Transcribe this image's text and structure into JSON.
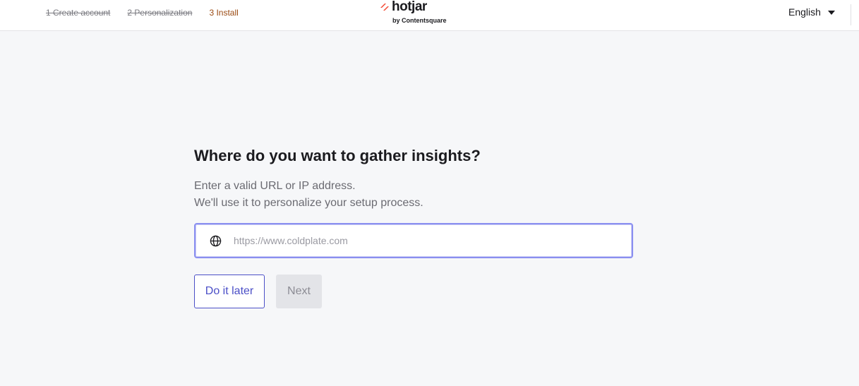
{
  "header": {
    "steps": [
      {
        "label": "1 Create account",
        "state": "done"
      },
      {
        "label": "2 Personalization",
        "state": "done"
      },
      {
        "label": "3 Install",
        "state": "current"
      }
    ],
    "logo": {
      "name": "hotjar",
      "tagline": "by Contentsquare",
      "mark_color": "#f4442e"
    },
    "language": {
      "selected": "English",
      "icon": "chevron-down-icon"
    }
  },
  "main": {
    "title": "Where do you want to gather insights?",
    "description_line1": "Enter a valid URL or IP address.",
    "description_line2": "We'll use it to personalize your setup process.",
    "url_field": {
      "icon": "globe-icon",
      "value": "",
      "placeholder": "https://www.coldplate.com"
    },
    "buttons": {
      "later_label": "Do it later",
      "next_label": "Next",
      "next_disabled": true
    }
  },
  "colors": {
    "accent": "#4b4fc7",
    "focus_border": "#8a8ff0",
    "background": "#f6f7f9",
    "current_step": "#9a4a12"
  }
}
